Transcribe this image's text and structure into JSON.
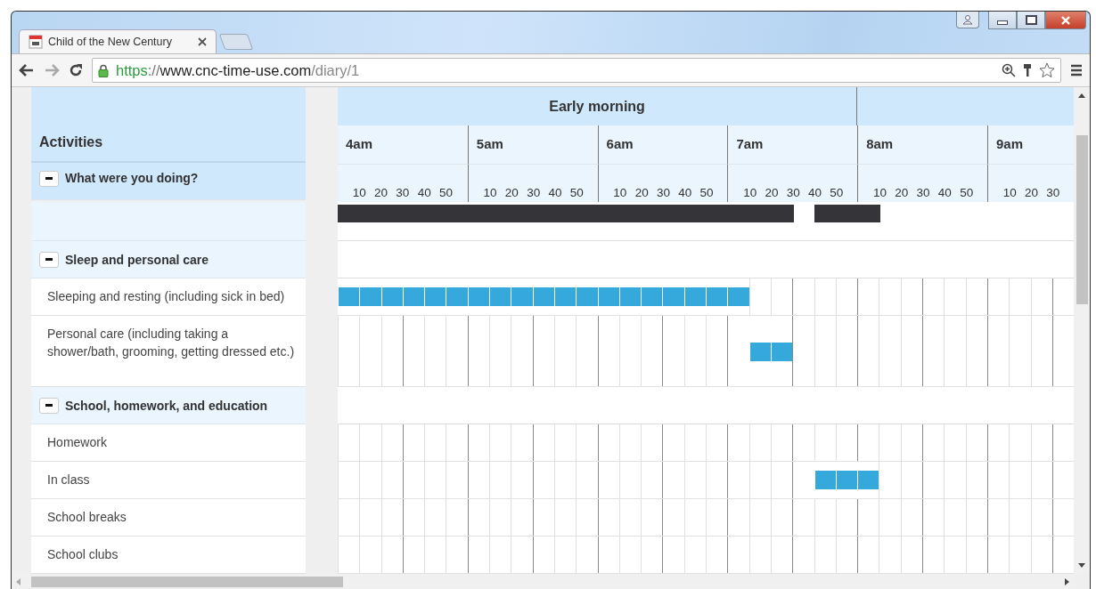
{
  "tab": {
    "title": "Child of the New Century",
    "selected": true
  },
  "address_bar": {
    "url": [
      {
        "kind": "scheme",
        "text": "https"
      },
      {
        "kind": "separator",
        "text": "://"
      },
      {
        "kind": "host",
        "text": "www.cnc-time-use.com"
      },
      {
        "kind": "path",
        "text": "/diary/1"
      }
    ]
  },
  "diary": {
    "activities_heading": "Activities",
    "periods": [
      {
        "label": "Early morning",
        "hours": [
          {
            "label": "4am",
            "minutes": [
              "10",
              "20",
              "30",
              "40",
              "50"
            ]
          },
          {
            "label": "5am",
            "minutes": [
              "10",
              "20",
              "30",
              "40",
              "50"
            ]
          },
          {
            "label": "6am",
            "minutes": [
              "10",
              "20",
              "30",
              "40",
              "50"
            ]
          },
          {
            "label": "7am",
            "minutes": [
              "10",
              "20",
              "30",
              "40",
              "50"
            ]
          }
        ]
      },
      {
        "hours": [
          {
            "label": "8am",
            "minutes": [
              "10",
              "20",
              "30",
              "40",
              "50"
            ]
          },
          {
            "label": "9am",
            "minutes": [
              "10",
              "20",
              "30"
            ]
          }
        ]
      }
    ],
    "sections": [
      {
        "kind": "summary",
        "title": "What were you doing?",
        "expanded": true
      },
      {
        "kind": "category",
        "title": "Sleep and personal care",
        "expanded": true,
        "activities": [
          {
            "label": "Sleeping and resting (including sick in bed)",
            "slots": [
              true,
              true,
              true,
              true,
              true,
              true,
              true,
              true,
              true,
              true,
              true,
              true,
              true,
              true,
              true,
              true,
              true,
              true,
              true,
              false,
              false,
              false,
              false,
              false,
              false,
              false,
              false,
              false,
              false,
              false,
              false,
              false,
              false,
              false
            ]
          },
          {
            "label": "Personal care (including taking a shower/bath, grooming, getting dressed etc.)",
            "slots": [
              false,
              false,
              false,
              false,
              false,
              false,
              false,
              false,
              false,
              false,
              false,
              false,
              false,
              false,
              false,
              false,
              false,
              false,
              false,
              true,
              true,
              false,
              false,
              false,
              false,
              false,
              false,
              false,
              false,
              false,
              false,
              false,
              false,
              false
            ]
          }
        ]
      },
      {
        "kind": "category",
        "title": "School, homework, and education",
        "expanded": true,
        "activities": [
          {
            "label": "Homework",
            "slots": [
              false,
              false,
              false,
              false,
              false,
              false,
              false,
              false,
              false,
              false,
              false,
              false,
              false,
              false,
              false,
              false,
              false,
              false,
              false,
              false,
              false,
              false,
              false,
              false,
              false,
              false,
              false,
              false,
              false,
              false,
              false,
              false,
              false,
              false
            ]
          },
          {
            "label": "In class",
            "slots": [
              false,
              false,
              false,
              false,
              false,
              false,
              false,
              false,
              false,
              false,
              false,
              false,
              false,
              false,
              false,
              false,
              false,
              false,
              false,
              false,
              false,
              false,
              true,
              true,
              true,
              false,
              false,
              false,
              false,
              false,
              false,
              false,
              false,
              false
            ]
          },
          {
            "label": "School breaks",
            "slots": [
              false,
              false,
              false,
              false,
              false,
              false,
              false,
              false,
              false,
              false,
              false,
              false,
              false,
              false,
              false,
              false,
              false,
              false,
              false,
              false,
              false,
              false,
              false,
              false,
              false,
              false,
              false,
              false,
              false,
              false,
              false,
              false,
              false,
              false
            ]
          },
          {
            "label": "School clubs",
            "slots": [
              false,
              false,
              false,
              false,
              false,
              false,
              false,
              false,
              false,
              false,
              false,
              false,
              false,
              false,
              false,
              false,
              false,
              false,
              false,
              false,
              false,
              false,
              false,
              false,
              false,
              false,
              false,
              false,
              false,
              false,
              false,
              false,
              false,
              false
            ]
          }
        ]
      }
    ]
  }
}
